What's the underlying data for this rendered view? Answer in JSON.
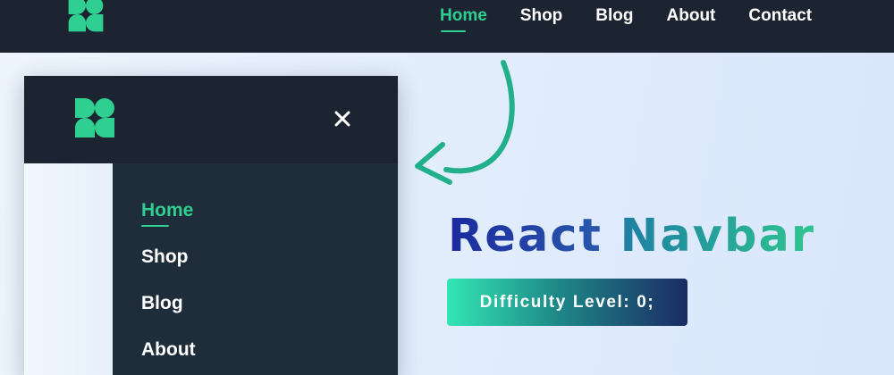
{
  "colors": {
    "navbar_bg": "#1c2331",
    "mobile_panel_bg": "#1f2c3a",
    "accent": "#2fcf91",
    "title_blue": "#1b2a9e",
    "title_teal": "#2ec68f",
    "page_bg": "#e3eefc"
  },
  "icons": {
    "logo": "clover-logo-icon",
    "close": "close-icon",
    "arrow": "curved-arrow-icon"
  },
  "topnav": {
    "items": [
      {
        "label": "Home",
        "active": true
      },
      {
        "label": "Shop",
        "active": false
      },
      {
        "label": "Blog",
        "active": false
      },
      {
        "label": "About",
        "active": false
      },
      {
        "label": "Contact",
        "active": false
      }
    ]
  },
  "mobile_menu": {
    "items": [
      {
        "label": "Home",
        "active": true
      },
      {
        "label": "Shop",
        "active": false
      },
      {
        "label": "Blog",
        "active": false
      },
      {
        "label": "About",
        "active": false
      }
    ]
  },
  "hero": {
    "title_word1": "React",
    "title_word2": "Navbar",
    "badge": "Difficulty Level: 0;"
  }
}
